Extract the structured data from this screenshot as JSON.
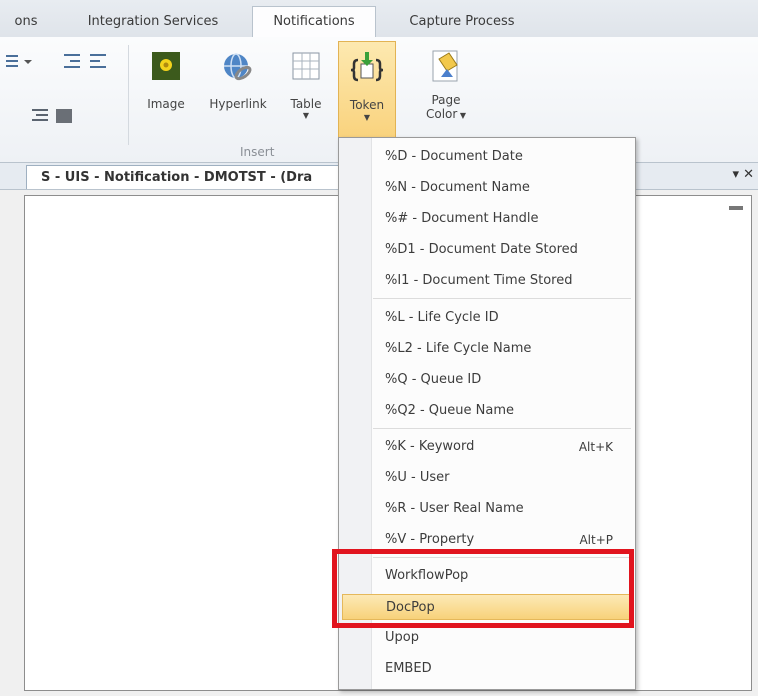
{
  "tabs": [
    "ons",
    "Integration Services",
    "Notifications",
    "Capture Process"
  ],
  "ribbon": {
    "buttons": {
      "image": "Image",
      "hyperlink": "Hyperlink",
      "table": "Table",
      "token": "Token",
      "page_color_line1": "Page",
      "page_color_line2": "Color"
    },
    "group_label": "Insert"
  },
  "document_tab": "S - UIS - Notification - DMOTST - (Dra",
  "window_controls": "▾ ✕",
  "token_menu": {
    "items": [
      {
        "label": "%D - Document Date"
      },
      {
        "label": "%N - Document Name"
      },
      {
        "label": "%# - Document Handle"
      },
      {
        "label": "%D1 - Document Date Stored"
      },
      {
        "label": "%I1 - Document Time Stored"
      },
      {
        "label": "%L - Life Cycle ID"
      },
      {
        "label": "%L2 - Life Cycle Name"
      },
      {
        "label": "%Q - Queue ID"
      },
      {
        "label": "%Q2 - Queue Name"
      },
      {
        "label": "%K - Keyword",
        "shortcut": "Alt+K"
      },
      {
        "label": "%U - User"
      },
      {
        "label": "%R - User Real Name"
      },
      {
        "label": "%V - Property",
        "shortcut": "Alt+P"
      },
      {
        "label": "WorkflowPop"
      },
      {
        "label": "DocPop",
        "highlighted": true
      },
      {
        "label": "Upop"
      },
      {
        "label": "EMBED"
      }
    ]
  },
  "colors": {
    "highlight_outline": "#e1141e",
    "hover_fill": "#f8d27a"
  }
}
